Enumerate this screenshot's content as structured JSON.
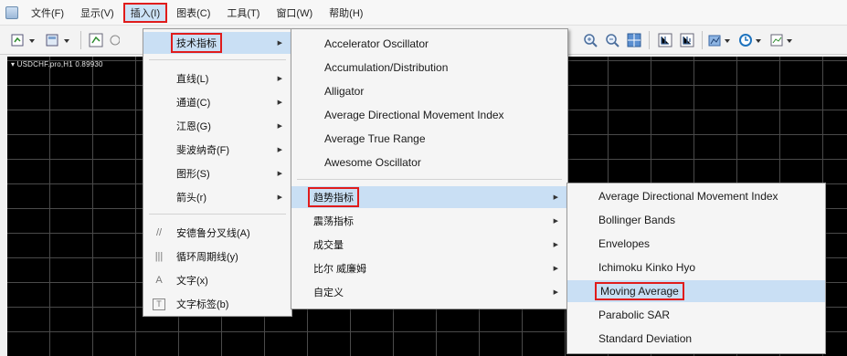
{
  "menubar": {
    "items": [
      "文件(F)",
      "显示(V)",
      "插入(I)",
      "图表(C)",
      "工具(T)",
      "窗口(W)",
      "帮助(H)"
    ]
  },
  "toolbar": {
    "left_icons": [
      "new-chart-icon",
      "profiles-icon",
      "zoom-icon"
    ],
    "right_icons": [
      "zoom-in-icon",
      "zoom-out-icon",
      "grid-icon",
      "autoscroll-icon",
      "chart-shift-icon",
      "indicators-icon",
      "periods-icon",
      "templates-icon"
    ]
  },
  "chart": {
    "label": "USDCHF.pro,H1  0.89930"
  },
  "insert_menu": {
    "items": [
      {
        "label": "技术指标"
      },
      {
        "label": "直线(L)"
      },
      {
        "label": "通道(C)"
      },
      {
        "label": "江恩(G)"
      },
      {
        "label": "斐波纳奇(F)"
      },
      {
        "label": "图形(S)"
      },
      {
        "label": "箭头(r)"
      },
      {
        "label": "安德鲁分叉线(A)"
      },
      {
        "label": "循环周期线(y)"
      },
      {
        "label": "文字(x)"
      },
      {
        "label": "文字标签(b)"
      }
    ],
    "icons": {
      "fork": "//",
      "cycle": "|||",
      "text": "A",
      "label": "T"
    }
  },
  "indicators_menu": {
    "oscillators": [
      "Accelerator Oscillator",
      "Accumulation/Distribution",
      "Alligator",
      "Average Directional Movement Index",
      "Average True Range",
      "Awesome Oscillator"
    ],
    "groups": [
      "趋势指标",
      "震荡指标",
      "成交量",
      "比尔 威廉姆",
      "自定义"
    ]
  },
  "trend_menu": {
    "items": [
      "Average Directional Movement Index",
      "Bollinger Bands",
      "Envelopes",
      "Ichimoku Kinko Hyo",
      "Moving Average",
      "Parabolic SAR",
      "Standard Deviation"
    ]
  },
  "colors": {
    "highlight": "#c9dff4",
    "annotation": "#e01c1c",
    "chart_bg": "#000000"
  }
}
